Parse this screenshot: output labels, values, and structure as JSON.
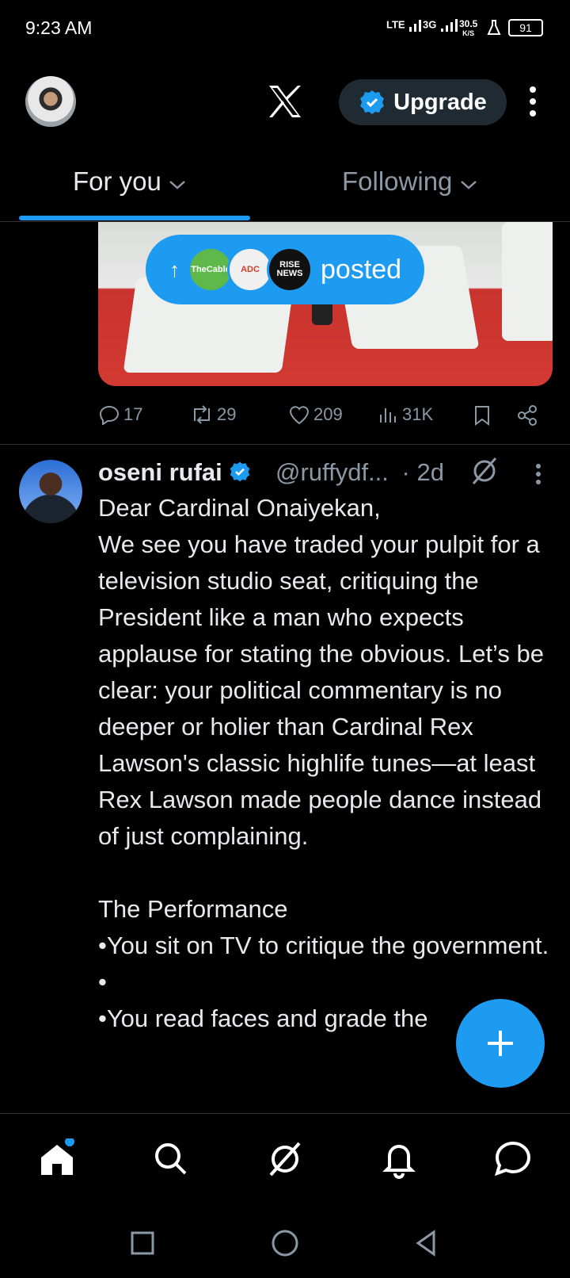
{
  "status_bar": {
    "time": "9:23 AM",
    "net1": "LTE",
    "net2": "3G",
    "speed": "30.5",
    "speed_unit": "K/S",
    "battery": "91"
  },
  "header": {
    "upgrade_label": "Upgrade"
  },
  "tabs": [
    {
      "label": "For you"
    },
    {
      "label": "Following"
    }
  ],
  "posted_pill": {
    "label": "posted",
    "sources": [
      "TheCable",
      "ADC",
      "RISE NEWS"
    ]
  },
  "post1": {
    "replies": "17",
    "reposts": "29",
    "likes": "209",
    "views": "31K"
  },
  "post2": {
    "author": "oseni rufai",
    "handle": "@ruffydf...",
    "age": "· 2d",
    "text": "Dear Cardinal Onaiyekan,\nWe see you have traded your pulpit for a television studio seat, critiquing the President like a man who expects applause for stating the obvious. Let’s be clear: your political commentary is no deeper or holier than Cardinal Rex Lawson's classic highlife tunes—at least Rex Lawson made people dance instead of just complaining.\n\nThe Performance\n•You sit on TV to critique the government.\n•\n•You read faces and grade the"
  },
  "icons": {
    "accent": "#1d9bf0",
    "background": "#000000",
    "muted": "#8b98a5"
  }
}
